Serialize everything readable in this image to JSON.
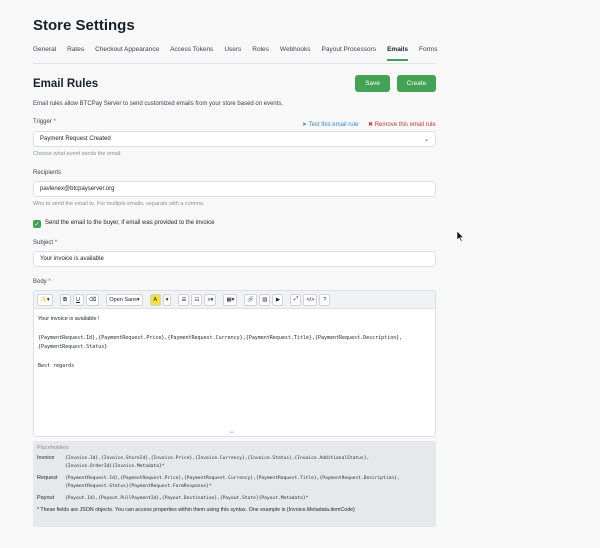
{
  "page": {
    "title": "Store Settings"
  },
  "nav": {
    "tabs": [
      {
        "label": "General"
      },
      {
        "label": "Rates"
      },
      {
        "label": "Checkout Appearance"
      },
      {
        "label": "Access Tokens"
      },
      {
        "label": "Users"
      },
      {
        "label": "Roles"
      },
      {
        "label": "Webhooks"
      },
      {
        "label": "Payout Processors"
      },
      {
        "label": "Emails",
        "active": true
      },
      {
        "label": "Forms"
      }
    ]
  },
  "section": {
    "title": "Email Rules",
    "save_label": "Save",
    "create_label": "Create",
    "description": "Email rules allow BTCPay Server to send customized emails from your store based on events."
  },
  "trigger": {
    "label": "Trigger",
    "required_mark": "*",
    "test_link": "Test this email rule",
    "remove_link": "Remove this email rule",
    "value": "Payment Request Created",
    "hint": "Choose what event sends the email."
  },
  "recipients": {
    "label": "Recipients",
    "value": "pavlenex@btcpayserver.org",
    "hint": "Who to send the email to. For multiple emails, separate with a comma."
  },
  "buyer_checkbox": {
    "checked": true,
    "label": "Send the email to the buyer, if email was provided to the invoice"
  },
  "subject": {
    "label": "Subject",
    "required_mark": "*",
    "value": "Your invoice is available"
  },
  "body": {
    "label": "Body",
    "required_mark": "*",
    "toolbar": {
      "font": "Open Sans"
    },
    "line1": "Your invoice is available !",
    "line2": "{PaymentRequest.Id},{PaymentRequest.Price},{PaymentRequest.Currency},{PaymentRequest.Title},{PaymentRequest.Description},",
    "line3": "{PaymentRequest.Status}",
    "line4": "Best regards"
  },
  "placeholders": {
    "title": "Placeholders",
    "rows": [
      {
        "name": "Invoice",
        "line1": "{Invoice.Id},{Invoice.StoreId},{Invoice.Price},{Invoice.Currency},{Invoice.Status},{Invoice.AdditionalStatus},",
        "line2": "{Invoice.OrderId}{Invoice.Metadata}*"
      },
      {
        "name": "Request",
        "line1": "{PaymentRequest.Id},{PaymentRequest.Price},{PaymentRequest.Currency},{PaymentRequest.Title},{PaymentRequest.Description},",
        "line2": "{PaymentRequest.Status}{PaymentRequest.FormResponse}*"
      },
      {
        "name": "Payout",
        "line1": "{Payout.Id},{Payout.PullPaymentId},{Payout.Destination},{Payout.State}{Payout.Metadata}*",
        "line2": ""
      }
    ],
    "note": "* These fields are JSON objects. You can access properties within them using this syntax. One example is {Invoice.Metadata.itemCode}"
  },
  "colors": {
    "accent": "#44a254",
    "link": "#3a86d4",
    "danger": "#c53b33"
  }
}
